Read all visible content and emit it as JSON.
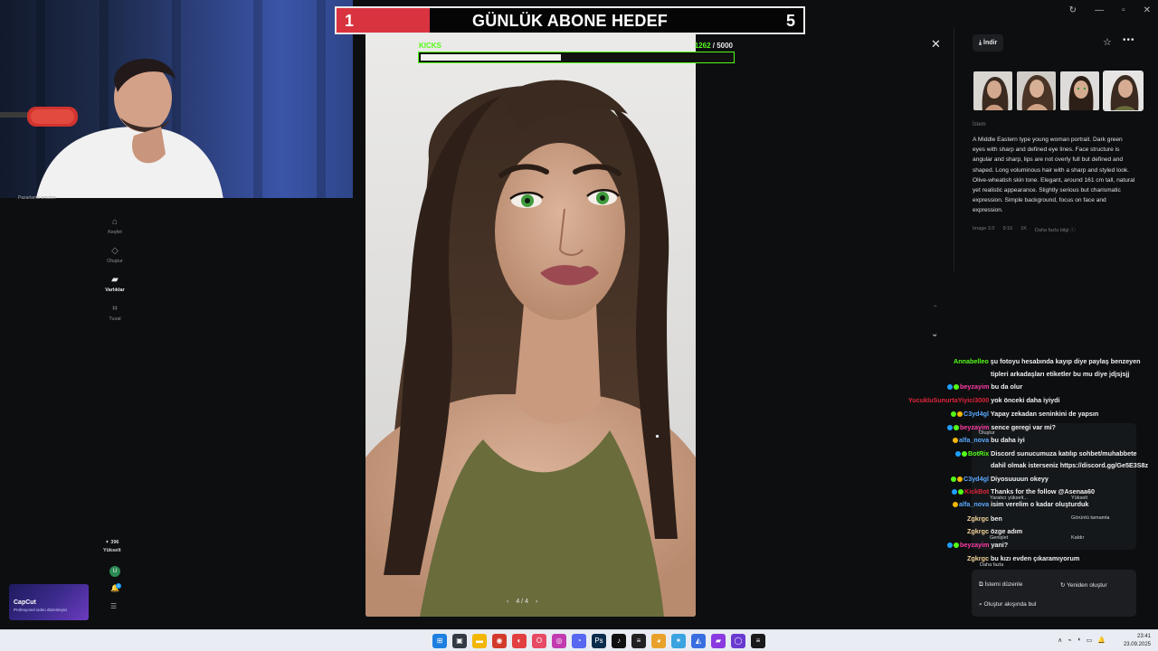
{
  "window": {
    "controls": [
      "↻",
      "—",
      "▫",
      "✕"
    ]
  },
  "goal": {
    "current": "1",
    "title": "GÜNLÜK ABONE HEDEF",
    "target": "5",
    "progress": 0.2,
    "fill_color": "#d9333f"
  },
  "kicks": {
    "label": "KICKS",
    "current": "1262",
    "separator": " / ",
    "target": "5000",
    "progress": 0.45,
    "accent": "#53fc18"
  },
  "webcam": {
    "caption": "Pazarlama aracları"
  },
  "nav": {
    "items": [
      {
        "icon": "⌂",
        "label": "Keşfet"
      },
      {
        "icon": "◇",
        "label": "Oluştur"
      },
      {
        "icon": "▰",
        "label": "Varlıklar"
      },
      {
        "icon": "⌗",
        "label": "Tuval"
      }
    ],
    "active_index": 2
  },
  "credits": {
    "amount": "✦ 396",
    "label": "Yükselt"
  },
  "user": {
    "initial": "U",
    "bell_count": "1"
  },
  "capcut": {
    "title": "CapCut",
    "subtitle": "Profesyonel video düzenleyici"
  },
  "viewer": {
    "pager_prev": "‹",
    "pager_text": "4 / 4",
    "pager_next": "›",
    "close": "✕"
  },
  "panel": {
    "download_label": "İndir",
    "prompt_label": "İstem",
    "prompt_text": "A Middle Eastern type young woman portrait. Dark green eyes with sharp and defined eye lines. Face structure is angular and sharp, lips are not overly full but defined and shaped. Long voluminous hair with a sharp and styled look. Olive-wheatish skin tone. Elegant, around 161 cm tall, natural yet realistic appearance. Slightly serious but charismatic expression. Simple background, focus on face and expression.",
    "meta": [
      "Image 3.0",
      "9:16",
      "1K",
      "Daha fazla bilgi ⓘ"
    ]
  },
  "chat": [
    {
      "user": "Annabelleo",
      "color": "#53fc18",
      "text": "şu fotoyu hesabında kayıp diye paylaş benzeyen",
      "badges": []
    },
    {
      "user": "",
      "color": "#ffffff",
      "text": "tipleri arkadaşları etiketler bu mu diye jdjsjsjj",
      "badges": []
    },
    {
      "user": "beyzayim",
      "color": "#ff3da6",
      "text": "bu da olur",
      "badges": [
        "#1ea0ff",
        "#53fc18"
      ]
    },
    {
      "user": "YucukluSunurtaYiyici3000",
      "color": "#e0253a",
      "text": "yok önceki daha iyiydi",
      "badges": []
    },
    {
      "user": "C3yd4gl",
      "color": "#59a9ff",
      "text": "Yapay zekadan seninkini de yapsın",
      "badges": [
        "#53fc18",
        "#f2b705"
      ]
    },
    {
      "user": "beyzayim",
      "color": "#ff3da6",
      "text": "sence geregi var mi?",
      "badges": [
        "#1ea0ff",
        "#53fc18"
      ]
    },
    {
      "user": "alfa_nova",
      "color": "#59a9ff",
      "text": "bu daha iyi",
      "badges": [
        "#f2b705"
      ]
    },
    {
      "user": "BotRix",
      "color": "#53fc18",
      "text": "Discord sunucumuza katılıp sohbet/muhabbete",
      "badges": [
        "#1ea0ff",
        "#53fc18"
      ]
    },
    {
      "user": "",
      "color": "#ffffff",
      "text": "dahil olmak isterseniz https://discord.gg/Ge5E3S8z",
      "badges": []
    },
    {
      "user": "C3yd4gl",
      "color": "#59a9ff",
      "text": "Diyosuuuun okeyy",
      "badges": [
        "#53fc18",
        "#f2b705"
      ]
    },
    {
      "user": "KickBot",
      "color": "#e0253a",
      "text": "Thanks for the follow @Asenaa60",
      "badges": [
        "#1ea0ff",
        "#53fc18"
      ]
    },
    {
      "user": "alfa_nova",
      "color": "#59a9ff",
      "text": "isim verelim o kadar oluşturduk",
      "badges": [
        "#f2b705"
      ]
    },
    {
      "user": "Zgkrgc",
      "color": "#f3d39a",
      "text": "ben",
      "badges": []
    },
    {
      "user": "Zgkrgc",
      "color": "#f3d39a",
      "text": "özge adım",
      "badges": []
    },
    {
      "user": "beyzayim",
      "color": "#ff3da6",
      "text": "yani?",
      "badges": [
        "#1ea0ff",
        "#53fc18"
      ]
    },
    {
      "user": "Zgkrgc",
      "color": "#f3d39a",
      "text": "bu kızı evden çıkaramıyorum",
      "badges": []
    }
  ],
  "context_menu": {
    "faded": [
      "Oluştur",
      "Yaratıcı yükselt...",
      "Yükselt",
      "Görüntü tamamla",
      "Genişlet",
      "Kaldır",
      "Daha fazla"
    ],
    "items": [
      "İstemi düzenle",
      "Yeniden oluştur",
      "Oluştur akışında bul"
    ]
  },
  "taskbar": {
    "apps": [
      {
        "glyph": "⊞",
        "color": "#1d7fe0"
      },
      {
        "glyph": "▣",
        "color": "#333a44"
      },
      {
        "glyph": "▬",
        "color": "#f2b705"
      },
      {
        "glyph": "◉",
        "color": "#d23a2b"
      },
      {
        "glyph": "◐",
        "color": "#e24040"
      },
      {
        "glyph": "O",
        "color": "#e84a66"
      },
      {
        "glyph": "◎",
        "color": "#c23bb0"
      },
      {
        "glyph": "◔",
        "color": "#5868f0"
      },
      {
        "glyph": "Ps",
        "color": "#0c2c4e"
      },
      {
        "glyph": "♪",
        "color": "#111111"
      },
      {
        "glyph": "≡",
        "color": "#222222"
      },
      {
        "glyph": "◕",
        "color": "#e8a22b"
      },
      {
        "glyph": "✶",
        "color": "#3aa3e0"
      },
      {
        "glyph": "◭",
        "color": "#3a6ee0"
      },
      {
        "glyph": "▰",
        "color": "#8a3ae0"
      },
      {
        "glyph": "◯",
        "color": "#6a3ad0"
      },
      {
        "glyph": "≡",
        "color": "#1a1a1a"
      }
    ],
    "tray": [
      "∧",
      "⌁",
      "◖",
      "▭",
      "🔔"
    ],
    "time": "23:41",
    "date": "23.09.2025"
  }
}
